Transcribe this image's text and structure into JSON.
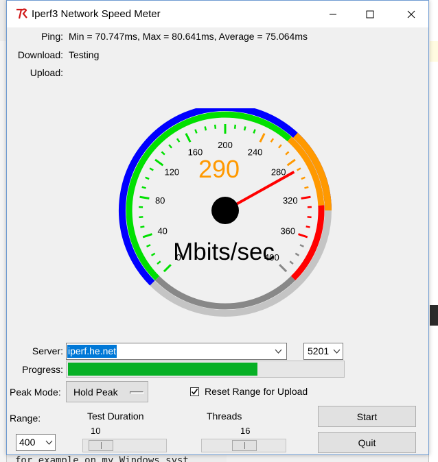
{
  "window": {
    "title": "Iperf3 Network Speed Meter",
    "icon": "tk-feather-icon"
  },
  "stats": {
    "ping_label": "Ping:",
    "ping_value": "Min = 70.747ms, Max = 80.641ms, Average = 75.064ms",
    "download_label": "Download:",
    "download_value": "Testing",
    "upload_label": "Upload:",
    "upload_value": ""
  },
  "gauge": {
    "readout": "290",
    "unit": "Mbits/sec",
    "needle_value": 290,
    "scale_min": 0,
    "scale_max": 400,
    "tick_labels": [
      "0",
      "40",
      "80",
      "120",
      "160",
      "200",
      "240",
      "280",
      "320",
      "360",
      "400"
    ],
    "colors": {
      "green": "#00e000",
      "orange": "#ff9900",
      "red": "#ff0000",
      "blue": "#0000ff",
      "gray": "#888888",
      "readout": "#ff9900",
      "needle": "#ff0000"
    }
  },
  "form": {
    "server_label": "Server:",
    "server_value": "iperf.he.net",
    "port_value": "5201",
    "progress_label": "Progress:",
    "progress_fraction": 0.69,
    "peak_mode_label": "Peak Mode:",
    "peak_mode_value": "Hold Peak",
    "reset_label": "Reset Range for Upload",
    "reset_checked": true,
    "range_label": "Range:",
    "range_value": "400",
    "test_duration_label": "Test Duration",
    "test_duration_value": "10",
    "threads_label": "Threads",
    "threads_value": "16",
    "start_label": "Start",
    "quit_label": "Quit"
  },
  "background": {
    "bottom_text": "for example on my Windows syst"
  }
}
